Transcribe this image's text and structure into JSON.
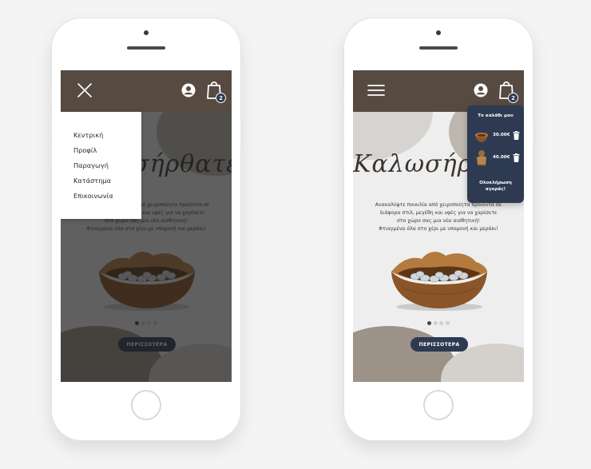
{
  "app": {
    "title": "Καλωσήρθατε"
  },
  "description": [
    "Ανακαλύψτε ποικιλία από χειροποίητα προϊόντα σε",
    "διάφορα στιλ, μεγέθη και υφές για να χαρίσετε",
    "στο χώρο σας μια νέα αισθητική!",
    "Φτιαγμένα όλα στο χέρι με υπομονή και μεράκι!"
  ],
  "header": {
    "cart_badge": "2"
  },
  "cta": {
    "label": "ΠΕΡΙΣΣΟΤΕΡΑ"
  },
  "carousel": {
    "count": 4,
    "active_index": 0
  },
  "menu": {
    "items": [
      {
        "label": "Κεντρική"
      },
      {
        "label": "Προφίλ"
      },
      {
        "label": "Παραγωγή"
      },
      {
        "label": "Κατάστημα"
      },
      {
        "label": "Επικοινωνία"
      }
    ]
  },
  "cart": {
    "title": "Το καλάθι μου",
    "items": [
      {
        "price": "30.00€",
        "thumb": "bowl-thumbnail"
      },
      {
        "price": "40.00€",
        "thumb": "figurine-thumbnail"
      }
    ],
    "checkout_label": [
      "Ολοκλήρωση",
      "αγοράς!"
    ]
  },
  "colors": {
    "header": "#574a41",
    "accent_button": "#2d3a52",
    "background": "#eeeeee"
  },
  "icons": [
    "close-icon",
    "hamburger-icon",
    "user-icon",
    "shopping-bag-icon",
    "trash-icon"
  ]
}
